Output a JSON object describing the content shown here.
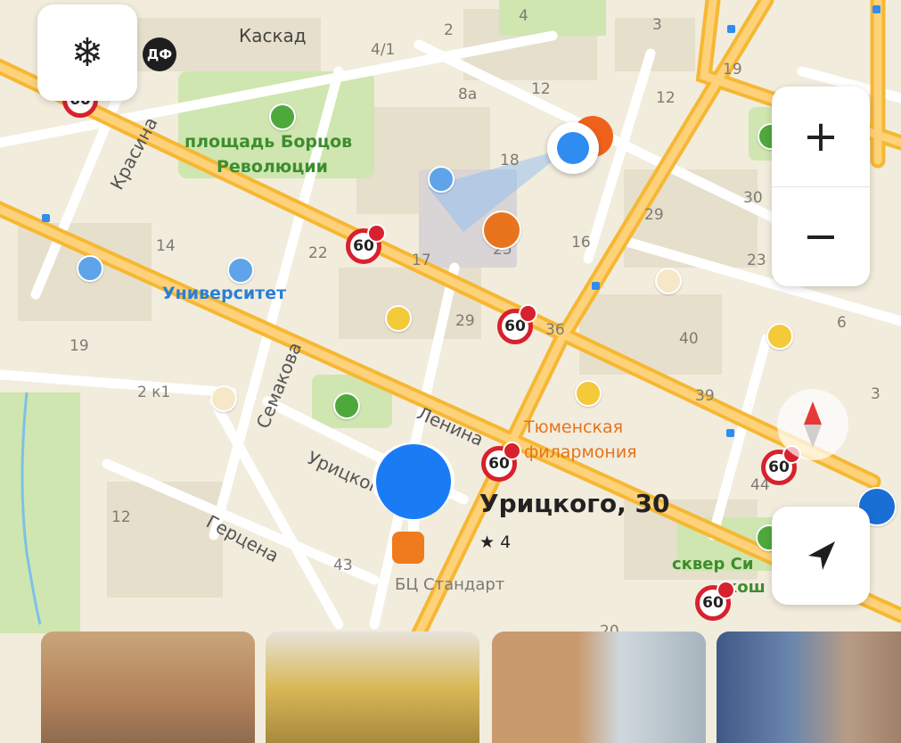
{
  "map": {
    "places": {
      "kaskad": "Каскад",
      "square": "площадь Борцов\nРеволюции",
      "square_line1": "площадь Борцов",
      "square_line2": "Революции",
      "university": "Университет",
      "philharmonic_line1": "Тюменская",
      "philharmonic_line2": "филармония",
      "business_center": "БЦ Стандарт",
      "square_partial_line1": "сквер Си",
      "square_partial_line2": "кош"
    },
    "streets": {
      "krasina": "Красина",
      "semakova": "Семакова",
      "lenina": "Ленина",
      "uritskogo": "Урицкого",
      "gertsena": "Герцена"
    },
    "house_numbers": [
      "4/1",
      "2",
      "4",
      "3",
      "8а",
      "12",
      "12",
      "19",
      "18",
      "30",
      "29",
      "23",
      "16",
      "25",
      "14",
      "22",
      "17",
      "29",
      "36",
      "40",
      "6",
      "19",
      "2 к1",
      "39",
      "3",
      "44",
      "12",
      "43",
      "20"
    ],
    "speed_limit": "60",
    "selected": {
      "address": "Урицкого, 30",
      "rating": "★ 4"
    },
    "badge": "ДФ"
  },
  "controls": {
    "freeze_icon": "snowflake-icon",
    "zoom_in_label": "+",
    "zoom_out_label": "−",
    "locate_icon": "navigation-arrow-icon",
    "compass_icon": "compass-icon"
  },
  "colors": {
    "major_road": "#f6b732",
    "minor_road": "#ffffff",
    "park": "#cfe8b2",
    "block": "#ebe4d3",
    "building": "#ddd6c3",
    "user_location": "#2f8cf0",
    "selected_pin": "#1a7cf5",
    "speed_border": "#d8212e"
  }
}
